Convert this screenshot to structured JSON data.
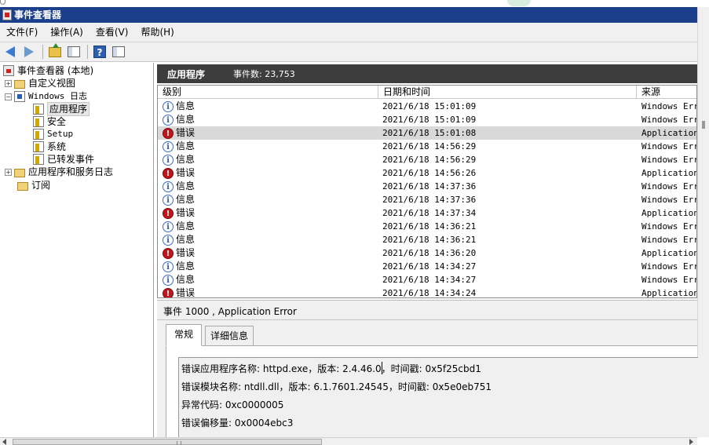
{
  "window": {
    "title": "事件查看器"
  },
  "menu": [
    "文件(F)",
    "操作(A)",
    "查看(V)",
    "帮助(H)"
  ],
  "toolbar": {
    "buttons": [
      "back-arrow-icon",
      "forward-arrow-icon",
      "folder-up-icon",
      "show-hide-tree-icon",
      "help-icon",
      "action-pane-icon"
    ]
  },
  "tree": {
    "root": "事件查看器 (本地)",
    "custom_views": "自定义视图",
    "windows_logs": "Windows 日志",
    "application": "应用程序",
    "security": "安全",
    "setup": "Setup",
    "system": "系统",
    "forwarded": "已转发事件",
    "app_services_logs": "应用程序和服务日志",
    "subscriptions": "订阅"
  },
  "pane": {
    "title": "应用程序",
    "count_label": "事件数: 23,753"
  },
  "table": {
    "columns": [
      "级别",
      "日期和时间",
      "来源"
    ],
    "rows": [
      {
        "level": "信息",
        "type": "info",
        "date": "2021/6/18 15:01:09",
        "source": "Windows Erro"
      },
      {
        "level": "信息",
        "type": "info",
        "date": "2021/6/18 15:01:09",
        "source": "Windows Erro"
      },
      {
        "level": "错误",
        "type": "error",
        "date": "2021/6/18 15:01:08",
        "source": "Application",
        "selected": true
      },
      {
        "level": "信息",
        "type": "info",
        "date": "2021/6/18 14:56:29",
        "source": "Windows Erro"
      },
      {
        "level": "信息",
        "type": "info",
        "date": "2021/6/18 14:56:29",
        "source": "Windows Erro"
      },
      {
        "level": "错误",
        "type": "error",
        "date": "2021/6/18 14:56:26",
        "source": "Application"
      },
      {
        "level": "信息",
        "type": "info",
        "date": "2021/6/18 14:37:36",
        "source": "Windows Erro"
      },
      {
        "level": "信息",
        "type": "info",
        "date": "2021/6/18 14:37:36",
        "source": "Windows Erro"
      },
      {
        "level": "错误",
        "type": "error",
        "date": "2021/6/18 14:37:34",
        "source": "Application"
      },
      {
        "level": "信息",
        "type": "info",
        "date": "2021/6/18 14:36:21",
        "source": "Windows Erro"
      },
      {
        "level": "信息",
        "type": "info",
        "date": "2021/6/18 14:36:21",
        "source": "Windows Erro"
      },
      {
        "level": "错误",
        "type": "error",
        "date": "2021/6/18 14:36:20",
        "source": "Application"
      },
      {
        "level": "信息",
        "type": "info",
        "date": "2021/6/18 14:34:27",
        "source": "Windows Erro"
      },
      {
        "level": "信息",
        "type": "info",
        "date": "2021/6/18 14:34:27",
        "source": "Windows Erro"
      },
      {
        "level": "错误",
        "type": "error",
        "date": "2021/6/18 14:34:24",
        "source": "Application"
      }
    ]
  },
  "detail": {
    "title": "事件 1000 , Application Error",
    "tabs": [
      "常规",
      "详细信息"
    ],
    "lines": [
      "错误应用程序名称: httpd.exe，版本: 2.4.46.0，时间戳: 0x5f25cbd1",
      "错误模块名称: ntdll.dll，版本: 6.1.7601.24545，时间戳: 0x5e0eb751",
      "异常代码: 0xc0000005",
      "错误偏移量: 0x0004ebc3"
    ]
  }
}
